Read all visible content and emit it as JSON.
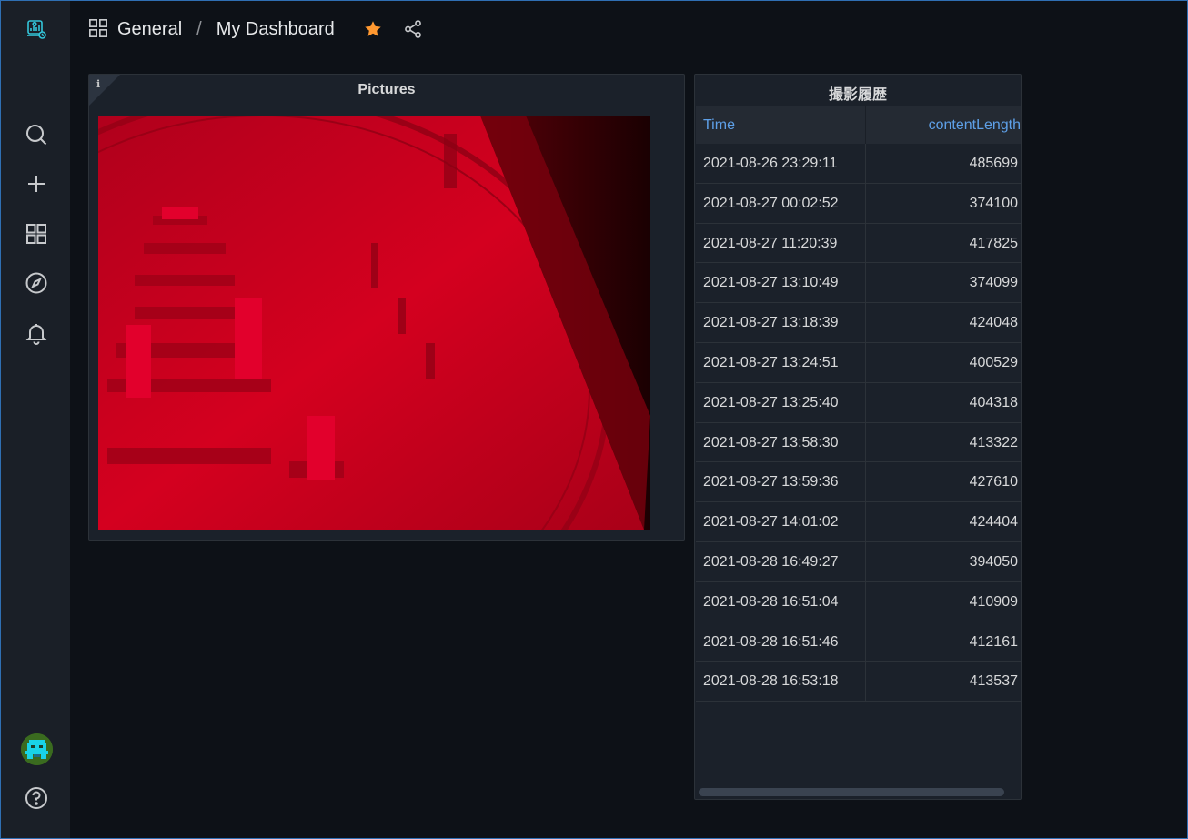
{
  "breadcrumb": {
    "folder": "General",
    "separator": "/",
    "dashboard": "My Dashboard"
  },
  "colors": {
    "accent_star": "#ff9830",
    "link_blue": "#5ea0e8",
    "logo_teal": "#33c5d9"
  },
  "sidebar": {
    "items": [
      {
        "icon": "search-icon"
      },
      {
        "icon": "plus-icon"
      },
      {
        "icon": "dashboards-icon"
      },
      {
        "icon": "explore-compass-icon"
      },
      {
        "icon": "alerting-bell-icon"
      }
    ],
    "help_icon": "help-icon"
  },
  "panels": {
    "pictures": {
      "title": "Pictures",
      "info": "i"
    },
    "history": {
      "title": "撮影履歴",
      "columns": [
        "Time",
        "contentLength"
      ],
      "rows": [
        [
          "2021-08-26 23:29:11",
          "485699"
        ],
        [
          "2021-08-27 00:02:52",
          "374100"
        ],
        [
          "2021-08-27 11:20:39",
          "417825"
        ],
        [
          "2021-08-27 13:10:49",
          "374099"
        ],
        [
          "2021-08-27 13:18:39",
          "424048"
        ],
        [
          "2021-08-27 13:24:51",
          "400529"
        ],
        [
          "2021-08-27 13:25:40",
          "404318"
        ],
        [
          "2021-08-27 13:58:30",
          "413322"
        ],
        [
          "2021-08-27 13:59:36",
          "427610"
        ],
        [
          "2021-08-27 14:01:02",
          "424404"
        ],
        [
          "2021-08-28 16:49:27",
          "394050"
        ],
        [
          "2021-08-28 16:51:04",
          "410909"
        ],
        [
          "2021-08-28 16:51:46",
          "412161"
        ],
        [
          "2021-08-28 16:53:18",
          "413537"
        ]
      ]
    }
  }
}
